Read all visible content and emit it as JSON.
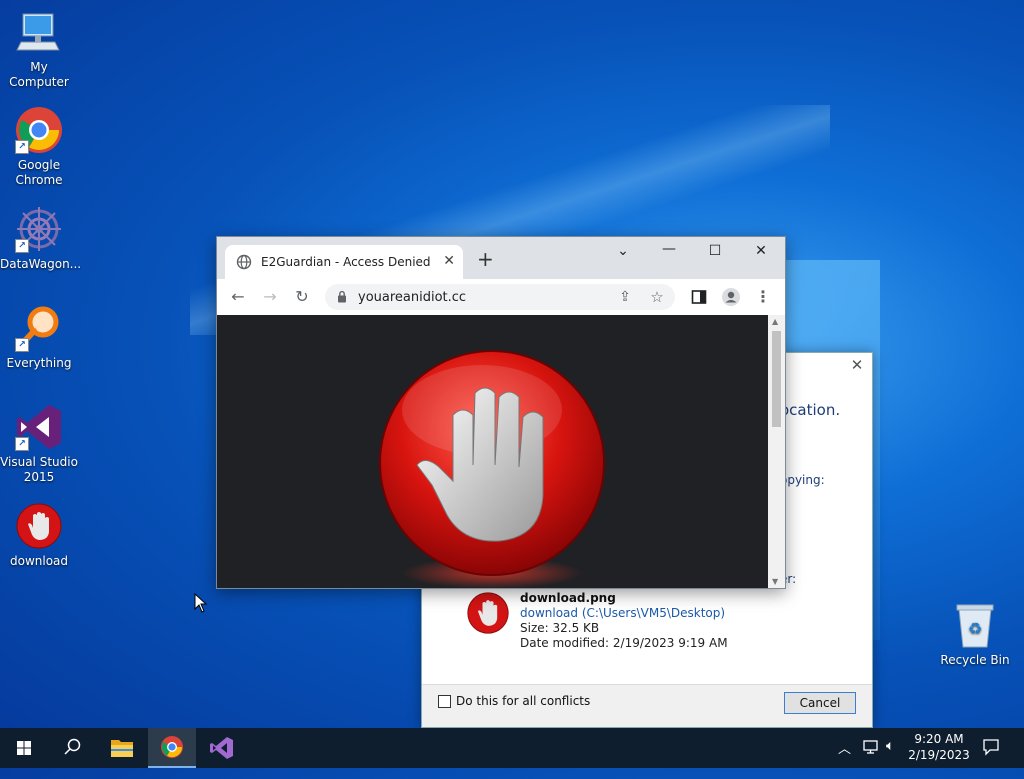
{
  "desktop": {
    "icons": [
      {
        "label": "My Computer"
      },
      {
        "label": "Google Chrome"
      },
      {
        "label": "DataWagon..."
      },
      {
        "label": "Everything"
      },
      {
        "label": "Visual Studio 2015"
      },
      {
        "label": "download"
      },
      {
        "label": "Recycle Bin"
      }
    ]
  },
  "browser": {
    "tab_title": "E2Guardian - Access Denied",
    "url": "youareanidiot.cc"
  },
  "dialog": {
    "text_location": "ocation.",
    "text_copying": "opying:",
    "text_er": "er:",
    "file_name": "download.png",
    "file_path": "download (C:\\Users\\VM5\\Desktop)",
    "file_size": "Size: 32.5 KB",
    "file_modified": "Date modified: 2/19/2023 9:19 AM",
    "checkbox_label": "Do this for all conflicts",
    "cancel_label": "Cancel"
  },
  "taskbar": {
    "time": "9:20 AM",
    "date": "2/19/2023"
  },
  "colors": {
    "desktop_blue": "#0752b8",
    "stop_red": "#d41414",
    "taskbar": "#0f1e2e"
  }
}
